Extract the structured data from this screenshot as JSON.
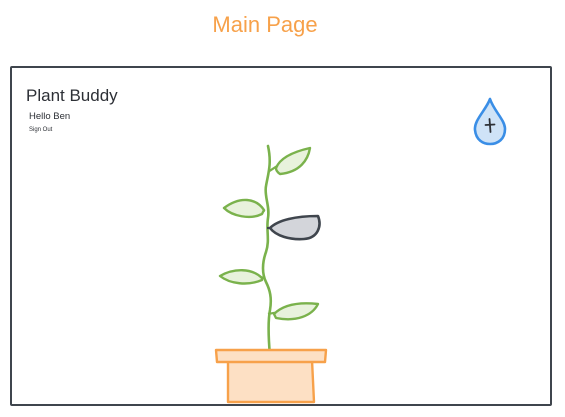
{
  "page": {
    "heading": "Main Page"
  },
  "app": {
    "title": "Plant Buddy",
    "greeting": "Hello Ben",
    "sign_out_label": "Sign Out"
  },
  "icons": {
    "water": "water-drop-icon",
    "plus": "plus-icon",
    "pot": "flower-pot-icon",
    "leaf": "leaf-icon"
  },
  "colors": {
    "heading": "#f7a14a",
    "frame_border": "#3f454d",
    "leaf_green": "#7ab24c",
    "leaf_fill": "#e8f2dc",
    "leaf_selected_fill": "#d3d5da",
    "water_blue": "#3a8ee6",
    "pot_orange": "#f7a14a",
    "pot_fill": "#fde0c4"
  }
}
